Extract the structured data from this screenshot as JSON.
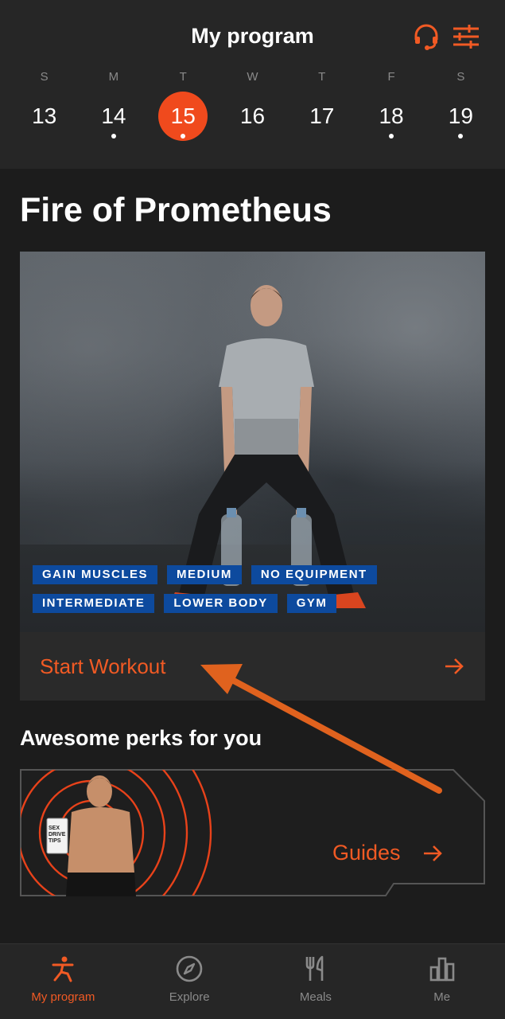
{
  "header": {
    "title": "My program",
    "icons": [
      "headset-icon",
      "filters-icon"
    ]
  },
  "week": [
    {
      "dow": "S",
      "date": "13",
      "selected": false,
      "has_activity": false
    },
    {
      "dow": "M",
      "date": "14",
      "selected": false,
      "has_activity": true
    },
    {
      "dow": "T",
      "date": "15",
      "selected": true,
      "has_activity": true
    },
    {
      "dow": "W",
      "date": "16",
      "selected": false,
      "has_activity": false
    },
    {
      "dow": "T",
      "date": "17",
      "selected": false,
      "has_activity": false
    },
    {
      "dow": "F",
      "date": "18",
      "selected": false,
      "has_activity": true
    },
    {
      "dow": "S",
      "date": "19",
      "selected": false,
      "has_activity": true
    }
  ],
  "program": {
    "title": "Fire of Prometheus",
    "tags_row1": [
      "GAIN MUSCLES",
      "MEDIUM",
      "NO EQUIPMENT"
    ],
    "tags_row2": [
      "INTERMEDIATE",
      "LOWER BODY",
      "GYM"
    ],
    "start_label": "Start Workout"
  },
  "perks": {
    "title": "Awesome perks for you",
    "card_label": "Guides",
    "book_text": "SEX DRIVE TIPS"
  },
  "tabs": [
    {
      "label": "My program",
      "icon": "workout-person-icon",
      "active": true
    },
    {
      "label": "Explore",
      "icon": "compass-icon",
      "active": false
    },
    {
      "label": "Meals",
      "icon": "fork-knife-icon",
      "active": false
    },
    {
      "label": "Me",
      "icon": "bar-chart-icon",
      "active": false
    }
  ],
  "colors": {
    "accent": "#f15a24",
    "selected_day": "#f04a1d",
    "tag_bg": "#0d4a9e",
    "background": "#1c1c1c",
    "surface": "#262626"
  }
}
